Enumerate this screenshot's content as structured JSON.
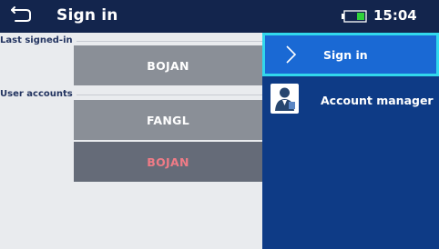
{
  "header": {
    "title": "Sign in",
    "time": "15:04",
    "back_icon": "back-arrow-icon",
    "battery_icon": "battery-icon"
  },
  "last_signed_in": {
    "label": "Last signed-in",
    "user": "BOJAN"
  },
  "user_accounts": {
    "label": "User accounts",
    "users": [
      "FANGL",
      "BOJAN"
    ],
    "selected": "BOJAN"
  },
  "menu": {
    "items": [
      {
        "label": "Sign in",
        "icon": "chevron-right-icon",
        "active": true
      },
      {
        "label": "Account manager",
        "icon": "account-manager-icon",
        "active": false
      }
    ]
  },
  "colors": {
    "header_bg": "#13254d",
    "menu_bg": "#0e3b86",
    "active_item_bg": "#1a69d4",
    "active_item_border": "#32d8ec",
    "selected_user_text": "#ef7b86"
  }
}
